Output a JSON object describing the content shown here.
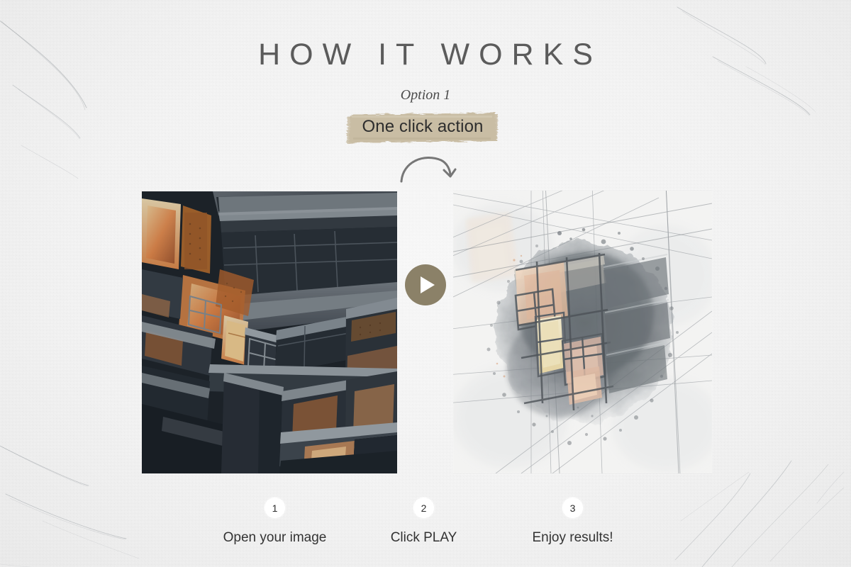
{
  "header": {
    "title": "HOW IT WORKS",
    "option_label": "Option 1",
    "highlight_label": "One click action"
  },
  "colors": {
    "background": "#ededed",
    "title_text": "#5b5b5b",
    "brush_highlight": "#c9bda4",
    "play_button": "#8b8168",
    "step_badge_bg": "#ffffff",
    "step_text": "#333333"
  },
  "icons": {
    "curved_arrow": "curved-arrow-icon",
    "play": "play-icon"
  },
  "media": {
    "before": {
      "alt": "Dark architectural photo of modern building facade with lit balconies"
    },
    "after": {
      "alt": "Watercolor sketch rendering of the same building facade"
    }
  },
  "steps": [
    {
      "number": "1",
      "label": "Open your image"
    },
    {
      "number": "2",
      "label": "Click PLAY"
    },
    {
      "number": "3",
      "label": "Enjoy results!"
    }
  ]
}
